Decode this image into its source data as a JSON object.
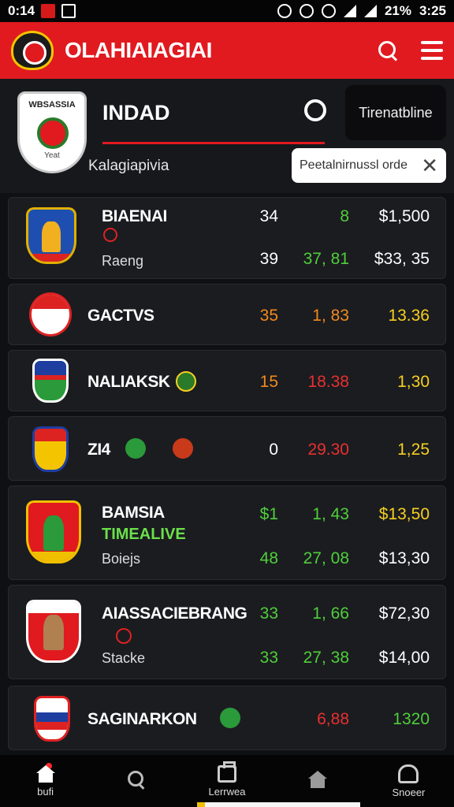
{
  "status_bar": {
    "time_left": "0:14",
    "battery": "21%",
    "time_right": "3:25"
  },
  "app": {
    "title": "OLAHIAIAGIAI"
  },
  "header": {
    "crest_ribbon": "WBSASSIA",
    "crest_footer": "Yeat",
    "team_title": "INDAD",
    "button_label": "Tirenatbline",
    "subtitle": "Kalagiapivia"
  },
  "tooltip": {
    "text": "Peetalnirnussl orde",
    "close": "✕"
  },
  "rows": [
    {
      "name": "BIAENAI",
      "sub": "Raeng",
      "c1": [
        "34",
        "39"
      ],
      "c2": [
        "8",
        "37, 81"
      ],
      "c3": [
        "$1,500",
        "$33, 35"
      ]
    },
    {
      "name": "GACTVS",
      "c1": [
        "35"
      ],
      "c2": [
        "1, 83"
      ],
      "c3": [
        "13.36"
      ]
    },
    {
      "name": "NALIAKSK",
      "c1": [
        "15"
      ],
      "c2": [
        "18.38"
      ],
      "c3": [
        "1,30"
      ]
    },
    {
      "name": "ZI4",
      "c1": [
        "0"
      ],
      "c2": [
        "29.30"
      ],
      "c3": [
        "1,25"
      ]
    },
    {
      "name": "BAMSIA",
      "green": "TIMEALIVE",
      "sub": "Boiejs",
      "c1": [
        "$1",
        "48"
      ],
      "c2": [
        "1, 43",
        "27, 08"
      ],
      "c3": [
        "$13,50",
        "$13,30"
      ]
    },
    {
      "name": "AIASSACIEBRANG",
      "sub": "Stacke",
      "c1": [
        "33",
        "33"
      ],
      "c2": [
        "1, 66",
        "27, 38"
      ],
      "c3": [
        "$72,30",
        "$14,00"
      ]
    },
    {
      "name": "SAGINARKON",
      "c2": [
        "6,88"
      ],
      "c3": [
        "1320"
      ]
    }
  ],
  "bottom_nav": [
    {
      "label": "bufi",
      "icon": "home-icon"
    },
    {
      "label": "",
      "icon": "search-icon"
    },
    {
      "label": "Lerrwea",
      "icon": "bag-icon"
    },
    {
      "label": "",
      "icon": "house-icon"
    },
    {
      "label": "Snoeer",
      "icon": "profile-icon"
    }
  ],
  "colors": {
    "brand_red": "#e01a1f",
    "green": "#4fcf3a",
    "orange": "#f08a1c",
    "red": "#e83030",
    "yellow": "#f5d020"
  }
}
